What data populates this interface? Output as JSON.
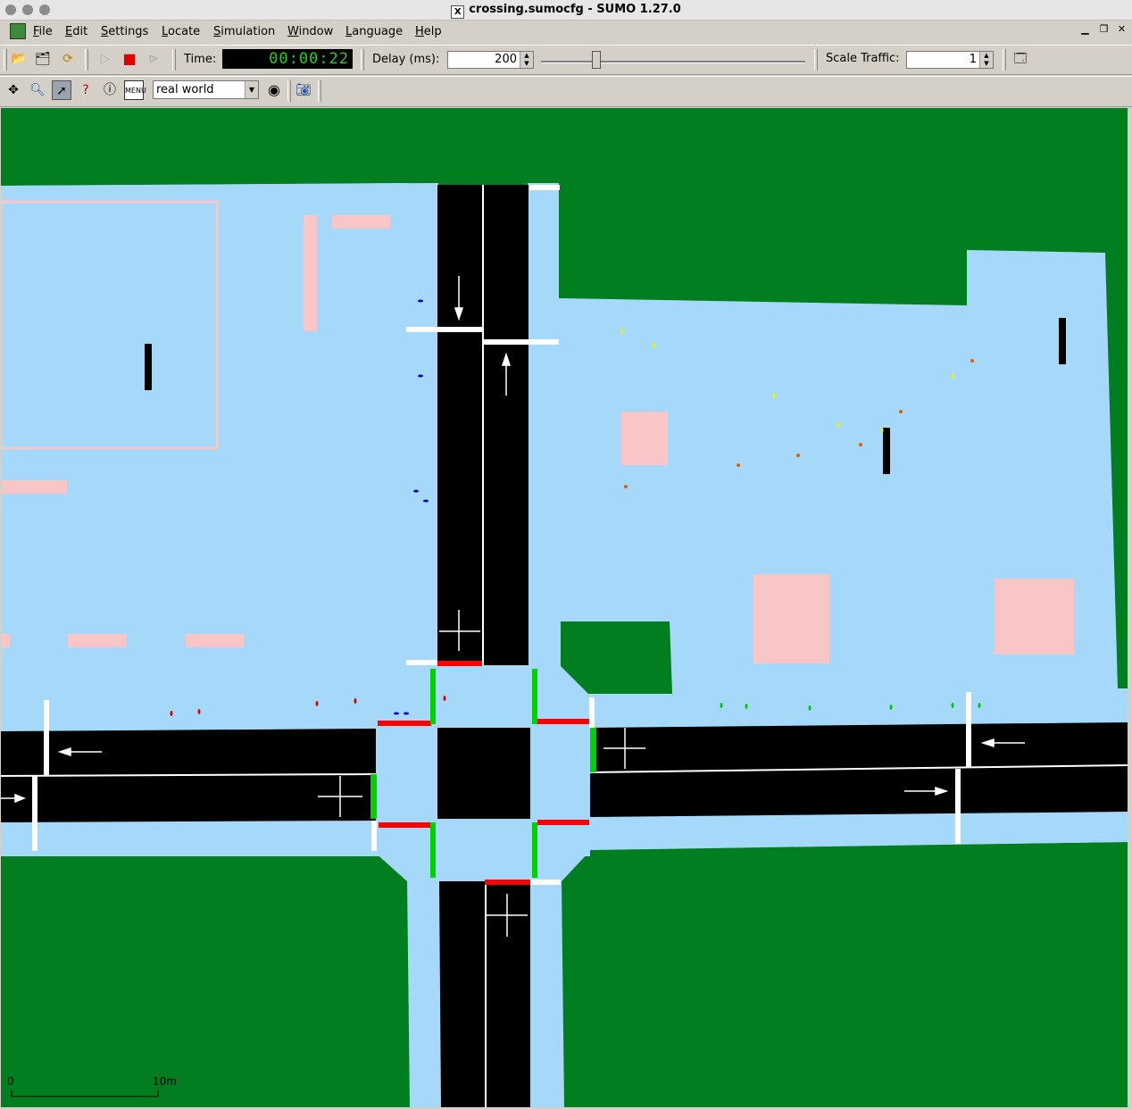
{
  "window": {
    "title": "crossing.sumocfg - SUMO 1.27.0",
    "x_glyph": "X"
  },
  "menu": {
    "file": "File",
    "edit": "Edit",
    "settings": "Settings",
    "locate": "Locate",
    "simulation": "Simulation",
    "window": "Window",
    "language": "Language",
    "help": "Help"
  },
  "toolbar": {
    "time_label": "Time:",
    "time_value": "00:00:22",
    "delay_label": "Delay (ms):",
    "delay_value": "200",
    "scale_label": "Scale Traffic:",
    "scale_value": "1"
  },
  "view_toolbar": {
    "scheme": "real world"
  },
  "icons": {
    "open": "folder-open-icon",
    "reload": "reload-icon",
    "run": "play-icon",
    "stop": "stop-icon",
    "step": "step-icon",
    "recenter": "recenter-icon",
    "locate": "magnifier-icon",
    "select": "select-pointer-icon",
    "query": "query-icon",
    "breakpoints": "breakpoints-icon",
    "menu": "menu-icon",
    "color": "color-wheel-icon",
    "screenshot": "camera-icon",
    "new_view": "new-view-icon"
  },
  "scale_bar": {
    "start": "0",
    "end": "10m"
  },
  "colors": {
    "grass": "#007e20",
    "sidewalk": "#a6d8fa",
    "road": "#000000",
    "building": "#f9c6c8",
    "signal_red": "#ff0000",
    "signal_green": "#00d200",
    "time_digits": "#1fd21f"
  }
}
